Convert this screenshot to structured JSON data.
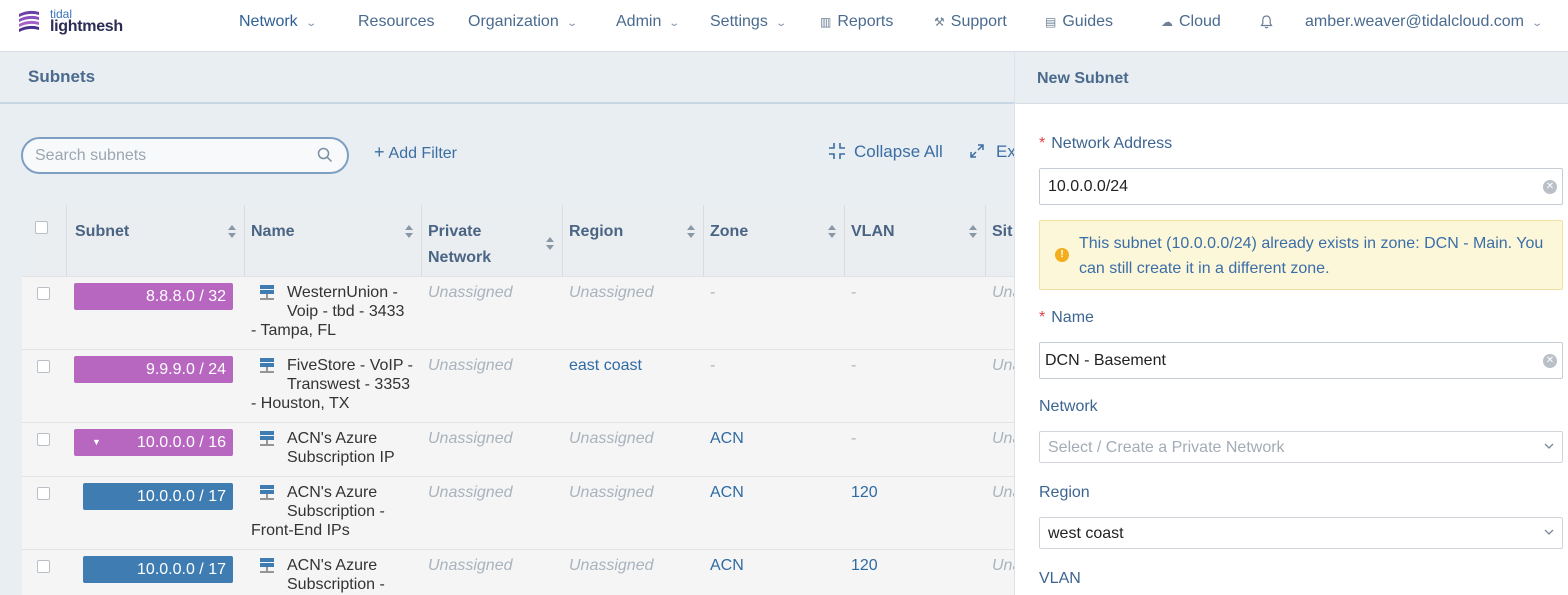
{
  "brand": {
    "top": "tidal",
    "bottom": "lightmesh"
  },
  "nav": {
    "network": "Network",
    "resources": "Resources",
    "organization": "Organization",
    "admin": "Admin",
    "settings": "Settings",
    "reports": "Reports",
    "support": "Support",
    "guides": "Guides",
    "cloud": "Cloud",
    "user": "amber.weaver@tidalcloud.com"
  },
  "page": {
    "title": "Subnets"
  },
  "toolbar": {
    "search_placeholder": "Search subnets",
    "add_filter": "Add Filter",
    "collapse_all": "Collapse All",
    "expand_all": "Ex"
  },
  "table": {
    "columns": [
      "Subnet",
      "Name",
      "Private Network",
      "Region",
      "Zone",
      "VLAN",
      "Sit"
    ],
    "rows": [
      {
        "subnet": "8.8.8.0 / 32",
        "color": "#b867c1",
        "name": "WesternUnion - Voip - tbd - 3433 - Tampa, FL",
        "name_lines": [
          "WesternUnion -",
          "Voip - tbd - 3433",
          "- Tampa, FL"
        ],
        "private_network": "Unassigned",
        "region": "Unassigned",
        "zone": "-",
        "vlan": "-",
        "site": "Una"
      },
      {
        "subnet": "9.9.9.0 / 24",
        "color": "#b867c1",
        "name": "FiveStore - VoIP - Transwest - 3353 - Houston, TX",
        "name_lines": [
          "FiveStore - VoIP -",
          "Transwest - 3353",
          "- Houston, TX"
        ],
        "private_network": "Unassigned",
        "region": "east coast",
        "zone": "-",
        "vlan": "-",
        "site": "Una"
      },
      {
        "subnet": "10.0.0.0 / 16",
        "color": "#b867c1",
        "name": "ACN's Azure Subscription IP",
        "name_lines": [
          "ACN's Azure",
          "Subscription IP"
        ],
        "private_network": "Unassigned",
        "region": "Unassigned",
        "zone": "ACN",
        "vlan": "-",
        "site": "Una"
      },
      {
        "subnet": "10.0.0.0 / 17",
        "color": "#3f7cb2",
        "name": "ACN's Azure Subscription - Front-End IPs",
        "name_lines": [
          "ACN's Azure",
          "Subscription -",
          "Front-End IPs"
        ],
        "private_network": "Unassigned",
        "region": "Unassigned",
        "zone": "ACN",
        "vlan": "120",
        "site": "Una"
      },
      {
        "subnet": "10.0.0.0 / 17",
        "color": "#3f7cb2",
        "name": "ACN's Azure Subscription -",
        "name_lines": [
          "ACN's Azure",
          "Subscription -"
        ],
        "private_network": "Unassigned",
        "region": "Unassigned",
        "zone": "ACN",
        "vlan": "120",
        "site": "Una"
      }
    ]
  },
  "panel": {
    "title": "New Subnet",
    "network_address_label": "Network Address",
    "network_address_value": "10.0.0.0/24",
    "warning": "This subnet (10.0.0.0/24) already exists in zone: DCN - Main. You can still create it in a different zone.",
    "name_label": "Name",
    "name_value": "DCN - Basement",
    "network_label": "Network",
    "network_placeholder": "Select / Create a Private Network",
    "region_label": "Region",
    "region_value": "west coast",
    "vlan_label": "VLAN"
  },
  "icons": {
    "logo": "tidal-logo-icon",
    "dropdown": "chevron-down-icon",
    "reports": "bar-chart-icon",
    "support": "wrench-icon",
    "guides": "book-icon",
    "cloud": "cloud-icon",
    "bell": "bell-icon",
    "search": "search-icon",
    "collapse": "collapse-icon",
    "expand": "expand-icon",
    "network_name": "server-network-icon",
    "warning": "warning-icon",
    "clear": "clear-icon"
  },
  "colors": {
    "accent": "#3b6ea3",
    "subnet_parent": "#b867c1",
    "subnet_child": "#3f7cb2",
    "required": "#e0414b",
    "warning_bg": "#fdf7d9"
  }
}
